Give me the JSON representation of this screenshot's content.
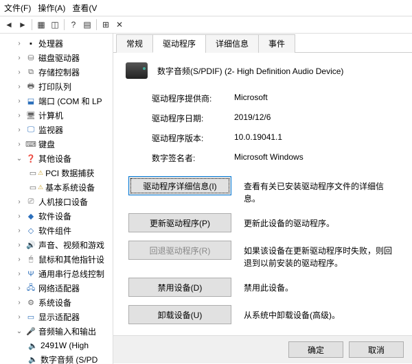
{
  "menu": {
    "file": "文件(F)",
    "action": "操作(A)",
    "view": "查看(V"
  },
  "tree": {
    "cpu": "处理器",
    "disk": "磁盘驱动器",
    "storage": "存储控制器",
    "printq": "打印队列",
    "ports": "端口 (COM 和 LP",
    "computer": "计算机",
    "monitor": "监视器",
    "keyboard": "键盘",
    "other": "其他设备",
    "pci": "PCI 数据捕获",
    "base": "基本系统设备",
    "hid": "人机接口设备",
    "sw": "软件设备",
    "swc": "软件组件",
    "sound": "声音、视频和游戏",
    "mouse": "鼠标和其他指针设",
    "usb": "通用串行总线控制",
    "net": "网络适配器",
    "sys": "系统设备",
    "display": "显示适配器",
    "audio": "音频输入和输出",
    "audio1": "2491W (High",
    "audio2": "数字音频 (S/PD"
  },
  "tabs": {
    "general": "常规",
    "driver": "驱动程序",
    "details": "详细信息",
    "events": "事件"
  },
  "device": {
    "title": "数字音频(S/PDIF) (2- High Definition Audio Device)"
  },
  "info": {
    "provider_label": "驱动程序提供商:",
    "provider": "Microsoft",
    "date_label": "驱动程序日期:",
    "date": "2019/12/6",
    "version_label": "驱动程序版本:",
    "version": "10.0.19041.1",
    "signer_label": "数字签名者:",
    "signer": "Microsoft Windows"
  },
  "actions": {
    "details_btn": "驱动程序详细信息(I)",
    "details_desc": "查看有关已安装驱动程序文件的详细信息。",
    "update_btn": "更新驱动程序(P)",
    "update_desc": "更新此设备的驱动程序。",
    "rollback_btn": "回退驱动程序(R)",
    "rollback_desc": "如果该设备在更新驱动程序时失败，则回退到以前安装的驱动程序。",
    "disable_btn": "禁用设备(D)",
    "disable_desc": "禁用此设备。",
    "uninstall_btn": "卸载设备(U)",
    "uninstall_desc": "从系统中卸载设备(高级)。"
  },
  "footer": {
    "ok": "确定",
    "cancel": "取消"
  }
}
